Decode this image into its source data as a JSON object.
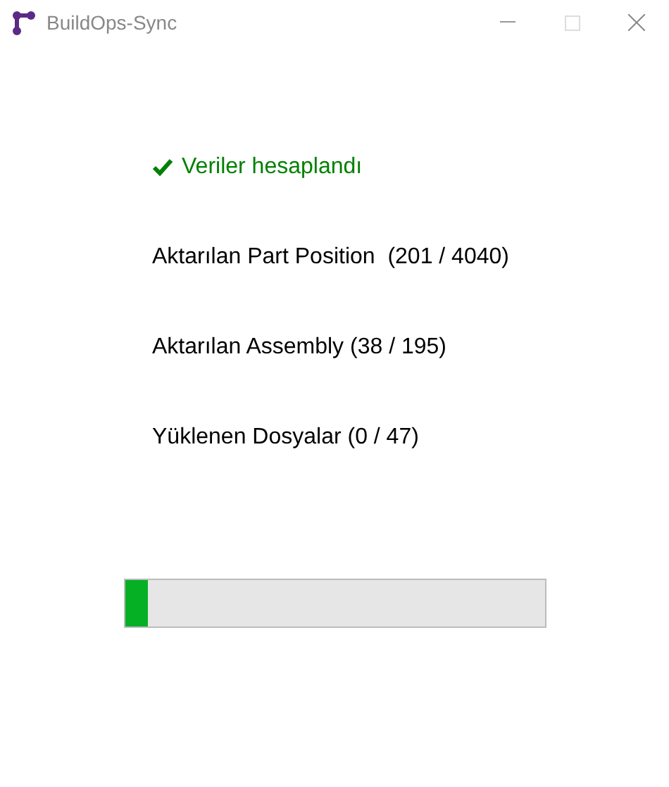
{
  "window": {
    "title": "BuildOps-Sync"
  },
  "status": {
    "text": "Veriler hesaplandı",
    "done": true
  },
  "counters": [
    {
      "text": "Aktarılan Part Position  (201 / 4040)"
    },
    {
      "text": "Aktarılan Assembly (38 / 195)"
    },
    {
      "text": "Yüklenen Dosyalar (0 / 47)"
    }
  ],
  "progress": {
    "level": 0.053
  }
}
